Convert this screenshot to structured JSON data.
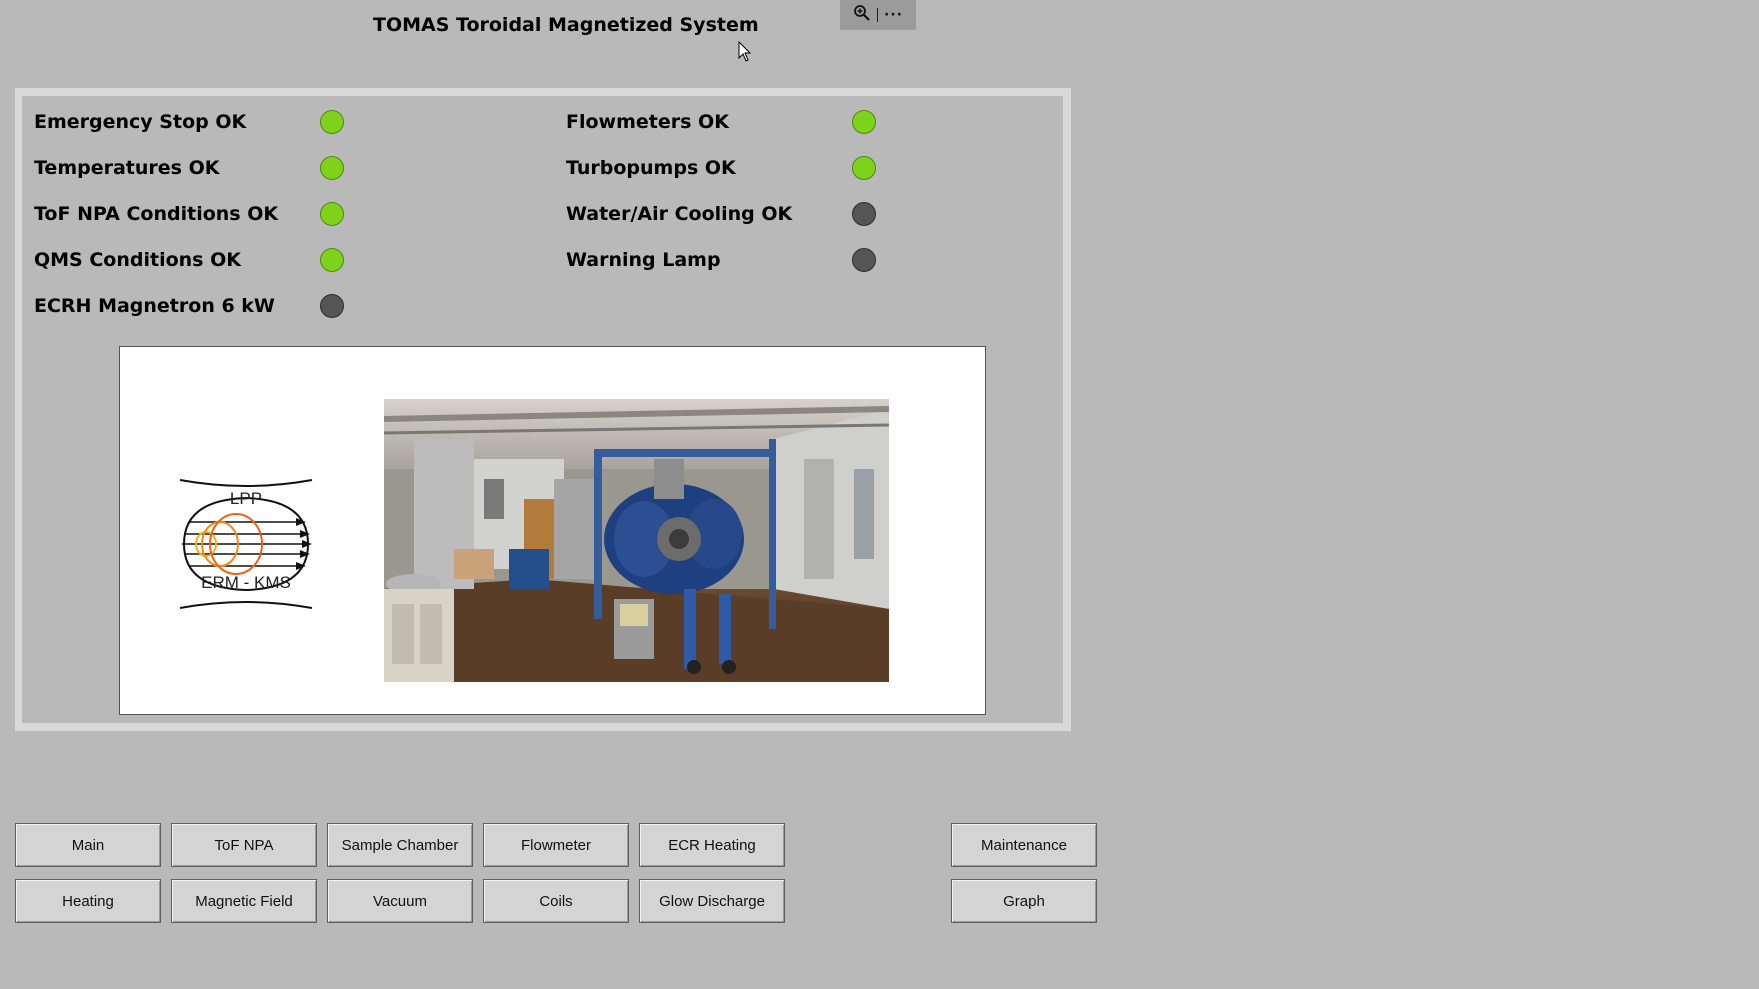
{
  "header": {
    "title": "TOMAS Toroidal Magnetized System"
  },
  "toolbar": {
    "zoom_icon": "zoom-in-icon",
    "more_label": "···"
  },
  "status": {
    "left": [
      {
        "label": "Emergency Stop OK",
        "state": "on"
      },
      {
        "label": "Temperatures OK",
        "state": "on"
      },
      {
        "label": "ToF NPA Conditions OK",
        "state": "on"
      },
      {
        "label": "QMS Conditions OK",
        "state": "on"
      },
      {
        "label": "ECRH Magnetron 6 kW",
        "state": "off"
      }
    ],
    "right": [
      {
        "label": "Flowmeters OK",
        "state": "on"
      },
      {
        "label": "Turbopumps OK",
        "state": "on"
      },
      {
        "label": "Water/Air Cooling OK",
        "state": "off"
      },
      {
        "label": "Warning Lamp",
        "state": "off"
      }
    ]
  },
  "colors": {
    "lamp_on": "#7ed21a",
    "lamp_off": "#555555",
    "background": "#b9b9b9"
  },
  "logo": {
    "top_text": "LPP",
    "bottom_text": "ERM - KMS"
  },
  "nav": {
    "row1": [
      "Main",
      "ToF NPA",
      "Sample Chamber",
      "Flowmeter",
      "ECR Heating"
    ],
    "row2": [
      "Heating",
      "Magnetic Field",
      "Vacuum",
      "Coils",
      "Glow Discharge"
    ],
    "maintenance": "Maintenance",
    "graph": "Graph"
  }
}
